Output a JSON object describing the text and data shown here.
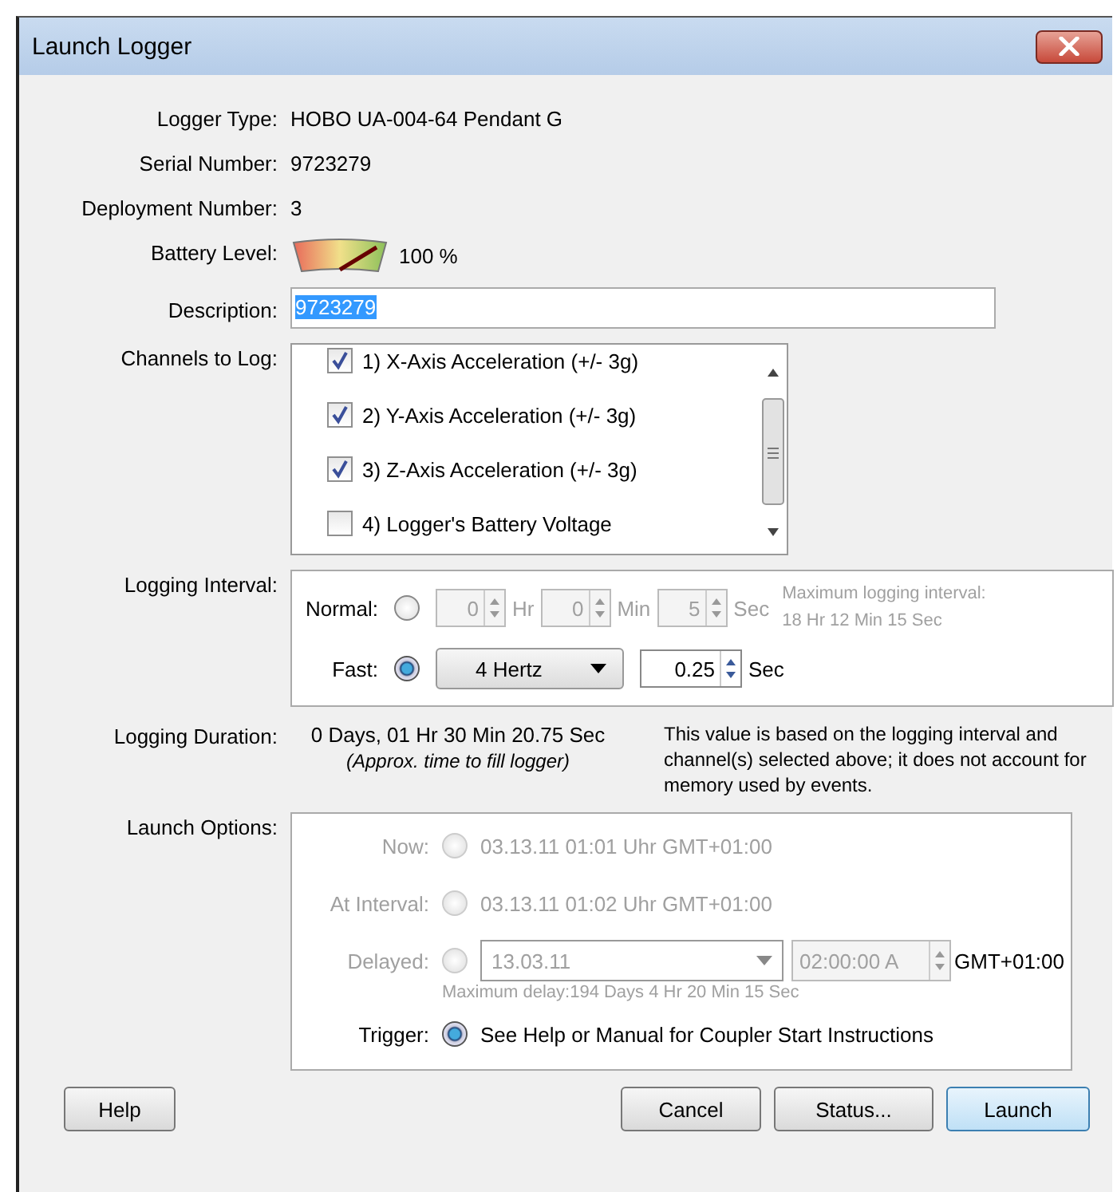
{
  "window": {
    "title": "Launch Logger"
  },
  "info": [
    {
      "label": "Logger Type:",
      "value": "HOBO UA-004-64 Pendant G"
    },
    {
      "label": "Serial Number:",
      "value": "9723279"
    },
    {
      "label": "Deployment Number:",
      "value": "3"
    }
  ],
  "battery": {
    "label": "Battery Level:",
    "reading": "100 %"
  },
  "description": {
    "label": "Description:",
    "value": "9723279",
    "selected": true
  },
  "channels": {
    "label": "Channels to Log:",
    "items": [
      {
        "label": "1) X-Axis Acceleration (+/- 3g)",
        "checked": true
      },
      {
        "label": "2) Y-Axis Acceleration (+/- 3g)",
        "checked": true
      },
      {
        "label": "3) Z-Axis Acceleration (+/- 3g)",
        "checked": true
      },
      {
        "label": "4) Logger's Battery Voltage",
        "checked": false
      }
    ]
  },
  "interval": {
    "label": "Logging Interval:",
    "normal": {
      "label": "Normal:",
      "selected": false,
      "fields": [
        {
          "value": "0",
          "unit": "Hr"
        },
        {
          "value": "0",
          "unit": "Min"
        },
        {
          "value": "5",
          "unit": "Sec"
        }
      ],
      "note_lines": [
        "Maximum logging interval:",
        "18 Hr 12 Min 15 Sec"
      ]
    },
    "fast": {
      "label": "Fast:",
      "selected": true,
      "rate": "4 Hertz",
      "value": "0.25",
      "unit": "Sec"
    }
  },
  "duration": {
    "label": "Logging Duration:",
    "value": "0 Days, 01 Hr 30 Min 20.75 Sec",
    "hint": "(Approx. time to fill logger)",
    "note": "This value is based on the logging interval and channel(s) selected above; it does not account for memory used by events."
  },
  "launch": {
    "label": "Launch Options:",
    "options": [
      {
        "kind": "text",
        "label": "Now:",
        "value": "03.13.11 01:01 Uhr GMT+01:00",
        "selected": false,
        "disabled": true
      },
      {
        "kind": "text",
        "label": "At Interval:",
        "value": "03.13.11 01:02 Uhr GMT+01:00",
        "selected": false,
        "disabled": true
      },
      {
        "kind": "delayed",
        "label": "Delayed:",
        "date": "13.03.11",
        "time": "02:00:00 A",
        "zone": "GMT+01:00",
        "note": "Maximum delay:194 Days  4 Hr 20 Min 15 Sec",
        "selected": false,
        "disabled": true
      },
      {
        "kind": "text",
        "label": "Trigger:",
        "value": "See Help or Manual for Coupler Start Instructions",
        "selected": true,
        "disabled": false
      }
    ]
  },
  "buttons": [
    {
      "label": "Help",
      "default": false
    },
    {
      "label": "Cancel",
      "default": false
    },
    {
      "label": "Status...",
      "default": false
    },
    {
      "label": "Launch",
      "default": true
    }
  ]
}
